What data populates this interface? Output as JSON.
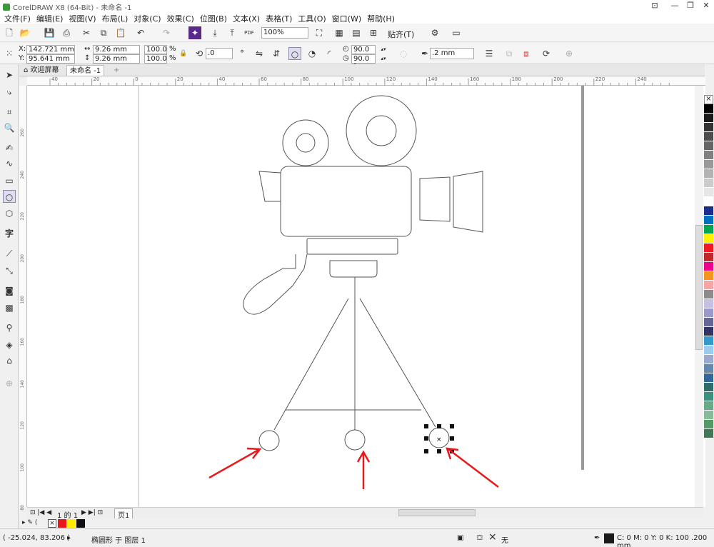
{
  "window": {
    "title": "CorelDRAW X8 (64-Bit) - 未命名 -1"
  },
  "menu": [
    "文件(F)",
    "编辑(E)",
    "视图(V)",
    "布局(L)",
    "对象(C)",
    "效果(C)",
    "位图(B)",
    "文本(X)",
    "表格(T)",
    "工具(O)",
    "窗口(W)",
    "帮助(H)"
  ],
  "toolbar": {
    "zoom": "100%",
    "snap_label": "贴齐(T)",
    "pdf_label": "PDF"
  },
  "props": {
    "x_label": "X:",
    "x": "142.721 mm",
    "y_label": "Y:",
    "y": "95.641 mm",
    "w": "9.26 mm",
    "h": "9.26 mm",
    "sx": "100.0",
    "sy": "100.0",
    "pct": "%",
    "rotation": ".0",
    "angle1": "90.0 °",
    "angle2": "90.0 °",
    "outline": ".2 mm"
  },
  "tabs": {
    "welcome": "欢迎屏幕",
    "doc": "未命名 -1",
    "add": "+"
  },
  "ruler": {
    "h_ticks": [
      "40",
      "20",
      "0",
      "20",
      "40",
      "60",
      "80",
      "100",
      "120",
      "140",
      "160",
      "180",
      "200",
      "220",
      "240"
    ],
    "v_ticks": [
      "260",
      "240",
      "220",
      "200",
      "180",
      "160",
      "140",
      "120",
      "100",
      "80"
    ]
  },
  "pagenav": {
    "pages": "1 的 1",
    "page_tab": "页1"
  },
  "status": {
    "coords": "( -25.024, 83.206 )",
    "object": "椭圆形 于 图层 1",
    "fill_none": "无",
    "color_info": "C: 0 M: 0 Y: 0 K: 100  .200 mm"
  },
  "colors": {
    "palette": [
      "#000000",
      "#1a1a1a",
      "#333333",
      "#4d4d4d",
      "#666666",
      "#808080",
      "#999999",
      "#b3b3b3",
      "#cccccc",
      "#e6e6e6",
      "#ffffff",
      "#1c2d8c",
      "#0070c0",
      "#00a651",
      "#fff200",
      "#ed1c24",
      "#c1272d",
      "#ec008c",
      "#f7941d",
      "#f4a6a6",
      "#8b8b8b",
      "#c7c0e0",
      "#9999cc",
      "#666699",
      "#333366",
      "#3399cc",
      "#99ccee",
      "#99aacc",
      "#6688aa",
      "#336699",
      "#2e6b6b",
      "#3f8f7f",
      "#66aa88",
      "#88bb99",
      "#559966",
      "#447755"
    ],
    "arrow": "#e8191a"
  }
}
